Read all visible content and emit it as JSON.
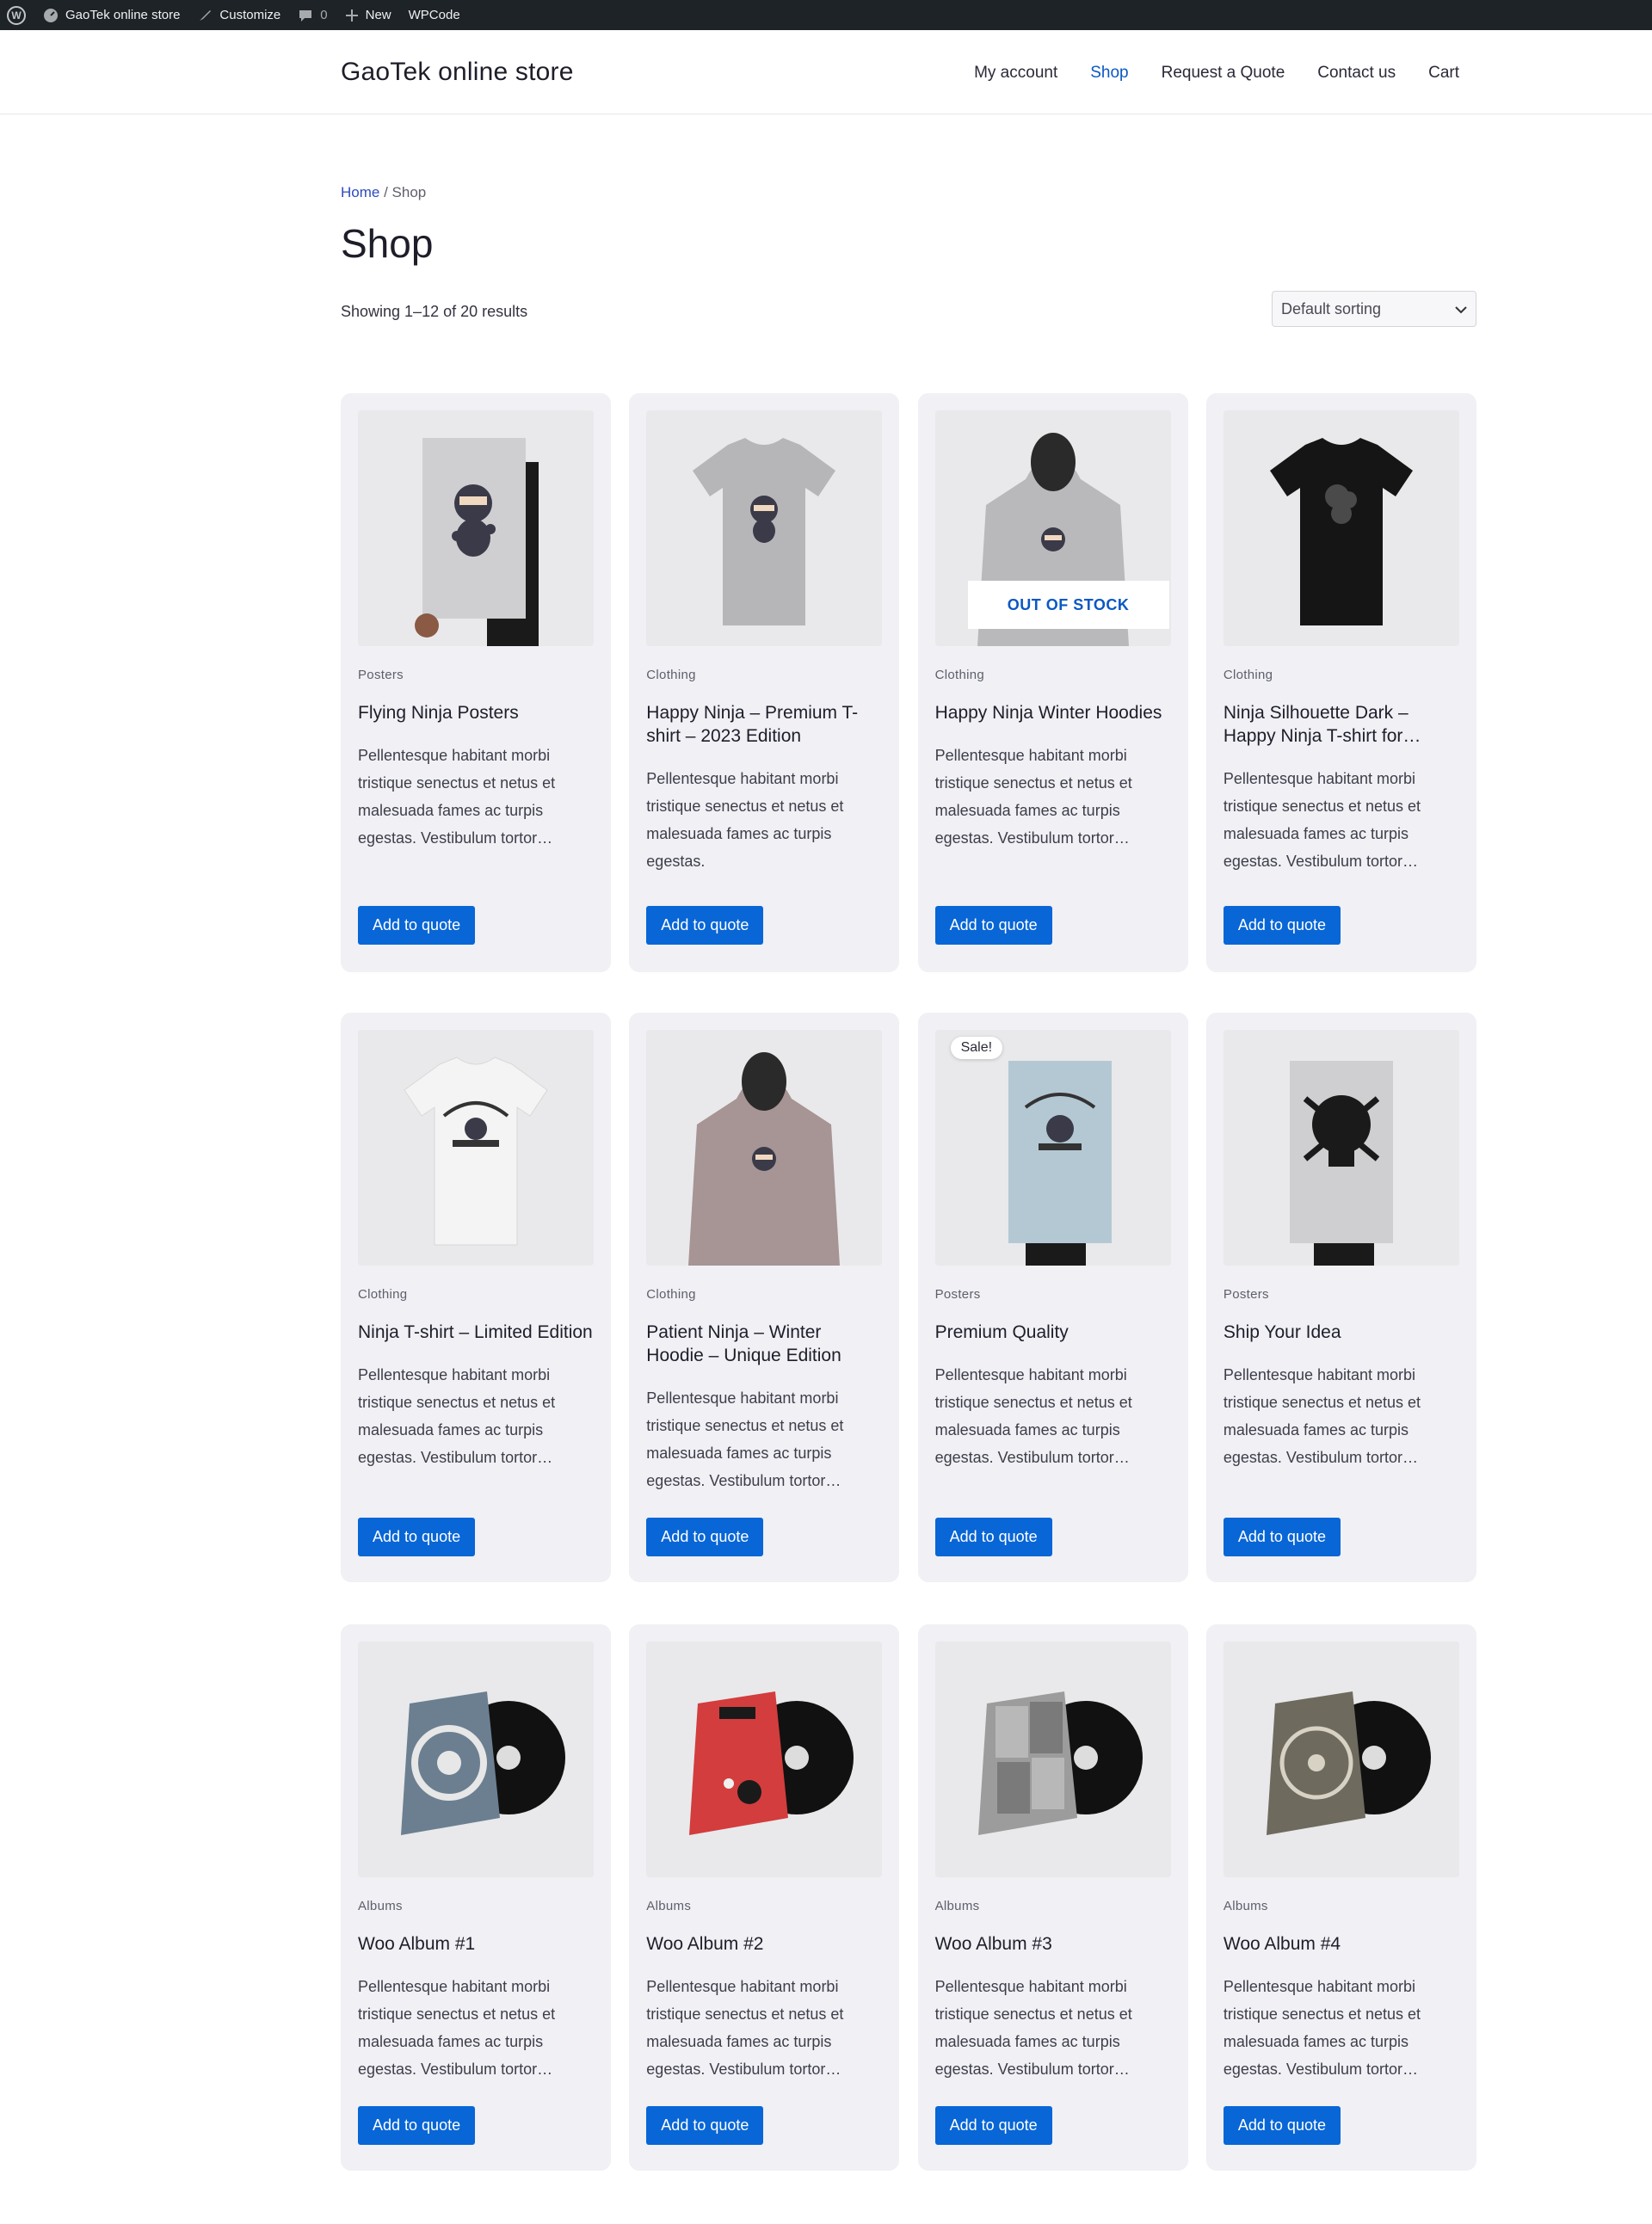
{
  "admin_bar": {
    "site_name": "GaoTek online store",
    "customize": "Customize",
    "comments_count": "0",
    "new": "New",
    "wpcode": "WPCode"
  },
  "header": {
    "site_title": "GaoTek online store",
    "nav": [
      {
        "label": "My account"
      },
      {
        "label": "Shop"
      },
      {
        "label": "Request a Quote"
      },
      {
        "label": "Contact us"
      },
      {
        "label": "Cart"
      }
    ],
    "active_nav": "Shop"
  },
  "breadcrumb": {
    "home": "Home",
    "sep": " / ",
    "current": "Shop"
  },
  "page_title": "Shop",
  "result_count": "Showing 1–12 of 20 results",
  "sorting": {
    "selected": "Default sorting"
  },
  "products": [
    {
      "category": "Posters",
      "title": "Flying Ninja Posters",
      "description": "Pellentesque habitant morbi tristique senectus et netus et malesuada fames ac turpis egestas. Vestibulum tortor…",
      "button": "Add to quote",
      "image": "poster-ninja-icon"
    },
    {
      "category": "Clothing",
      "title": "Happy Ninja – Premium T-shirt – 2023 Edition",
      "description": "Pellentesque habitant morbi tristique senectus et netus et malesuada fames ac turpis egestas.",
      "button": "Add to quote",
      "image": "tshirt-grey-icon"
    },
    {
      "category": "Clothing",
      "title": "Happy Ninja Winter Hoodies",
      "description": "Pellentesque habitant morbi tristique senectus et netus et malesuada fames ac turpis egestas. Vestibulum tortor…",
      "button": "Add to quote",
      "badge": "OUT OF STOCK",
      "image": "hoodie-grey-icon"
    },
    {
      "category": "Clothing",
      "title": "Ninja Silhouette Dark – Happy Ninja T-shirt for…",
      "description": "Pellentesque habitant morbi tristique senectus et netus et malesuada fames ac turpis egestas. Vestibulum tortor…",
      "button": "Add to quote",
      "image": "tshirt-black-icon"
    },
    {
      "category": "Clothing",
      "title": "Ninja T-shirt – Limited Edition",
      "description": "Pellentesque habitant morbi tristique senectus et netus et malesuada fames ac turpis egestas. Vestibulum tortor…",
      "button": "Add to quote",
      "image": "tshirt-white-icon"
    },
    {
      "category": "Clothing",
      "title": "Patient Ninja – Winter Hoodie – Unique Edition",
      "description": "Pellentesque habitant morbi tristique senectus et netus et malesuada fames ac turpis egestas. Vestibulum tortor…",
      "button": "Add to quote",
      "image": "hoodie-mauve-icon"
    },
    {
      "category": "Posters",
      "title": "Premium Quality",
      "description": "Pellentesque habitant morbi tristique senectus et netus et malesuada fames ac turpis egestas. Vestibulum tortor…",
      "button": "Add to quote",
      "badge": "Sale!",
      "image": "poster-woothemes-icon"
    },
    {
      "category": "Posters",
      "title": "Ship Your Idea",
      "description": "Pellentesque habitant morbi tristique senectus et netus et malesuada fames ac turpis egestas. Vestibulum tortor…",
      "button": "Add to quote",
      "image": "poster-skull-icon"
    },
    {
      "category": "Albums",
      "title": "Woo Album #1",
      "description": "Pellentesque habitant morbi tristique senectus et netus et malesuada fames ac turpis egestas. Vestibulum tortor…",
      "button": "Add to quote",
      "image": "album-blue-icon"
    },
    {
      "category": "Albums",
      "title": "Woo Album #2",
      "description": "Pellentesque habitant morbi tristique senectus et netus et malesuada fames ac turpis egestas. Vestibulum tortor…",
      "button": "Add to quote",
      "image": "album-red-icon"
    },
    {
      "category": "Albums",
      "title": "Woo Album #3",
      "description": "Pellentesque habitant morbi tristique senectus et netus et malesuada fames ac turpis egestas. Vestibulum tortor…",
      "button": "Add to quote",
      "image": "album-grey-icon"
    },
    {
      "category": "Albums",
      "title": "Woo Album #4",
      "description": "Pellentesque habitant morbi tristique senectus et netus et malesuada fames ac turpis egestas. Vestibulum tortor…",
      "button": "Add to quote",
      "image": "album-photo-icon"
    }
  ],
  "colors": {
    "accent": "#0866d6",
    "nav_active": "#0a58c4",
    "card_bg": "#f0f0f5",
    "admin_bar": "#1d2327"
  }
}
